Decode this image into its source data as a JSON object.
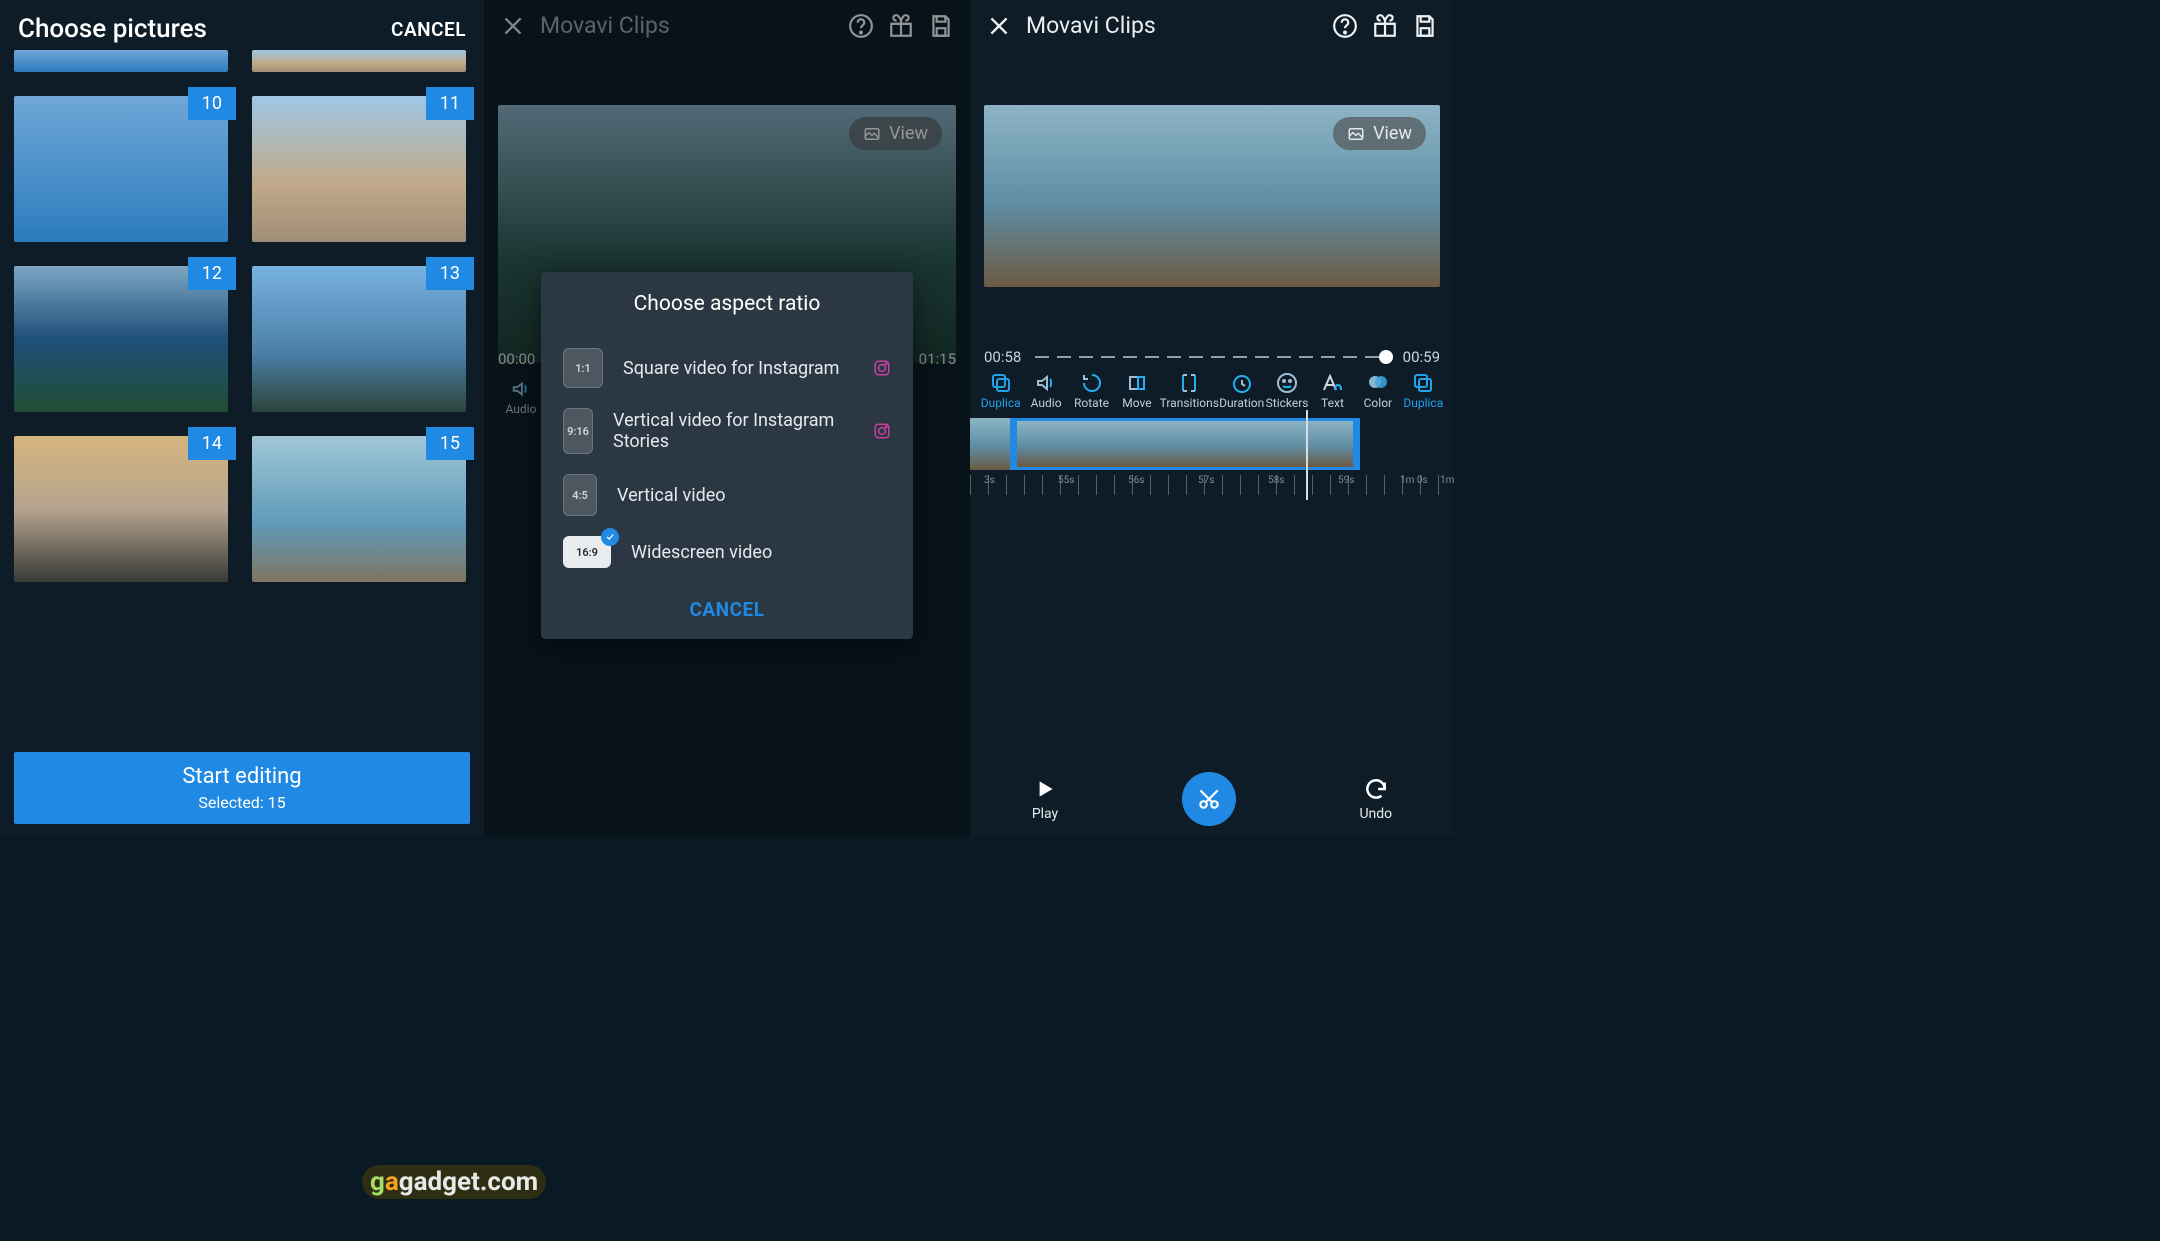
{
  "panel1": {
    "title": "Choose pictures",
    "cancel": "CANCEL",
    "thumbs": [
      {
        "badge": "10"
      },
      {
        "badge": "11"
      },
      {
        "badge": "12"
      },
      {
        "badge": "13"
      },
      {
        "badge": "14"
      },
      {
        "badge": "15"
      }
    ],
    "start": "Start editing",
    "selected": "Selected: 15"
  },
  "watermark": "gagadget.com",
  "panel2": {
    "app_title": "Movavi Clips",
    "view": "View",
    "time_left": "00:00",
    "time_right": "01:15",
    "tools": [
      "Audio"
    ],
    "dialog": {
      "title": "Choose aspect ratio",
      "options": [
        {
          "ratio": "1:1",
          "label": "Square video for Instagram",
          "ig": true,
          "selected": false
        },
        {
          "ratio": "9:16",
          "label": "Vertical video for Instagram Stories",
          "ig": true,
          "selected": false
        },
        {
          "ratio": "4:5",
          "label": "Vertical video",
          "ig": false,
          "selected": false
        },
        {
          "ratio": "16:9",
          "label": "Widescreen video",
          "ig": false,
          "selected": true
        }
      ],
      "cancel": "CANCEL"
    }
  },
  "panel3": {
    "app_title": "Movavi Clips",
    "view": "View",
    "time_left": "00:58",
    "time_right": "00:59",
    "tools": [
      {
        "label": "Duplica"
      },
      {
        "label": "Audio"
      },
      {
        "label": "Rotate"
      },
      {
        "label": "Move"
      },
      {
        "label": "Transitions"
      },
      {
        "label": "Duration"
      },
      {
        "label": "Stickers"
      },
      {
        "label": "Text"
      },
      {
        "label": "Color"
      },
      {
        "label": "Duplica"
      }
    ],
    "ruler": [
      "3s",
      "55s",
      "56s",
      "57s",
      "58s",
      "59s",
      "1m 0s",
      "1m"
    ],
    "play": "Play",
    "undo": "Undo"
  }
}
